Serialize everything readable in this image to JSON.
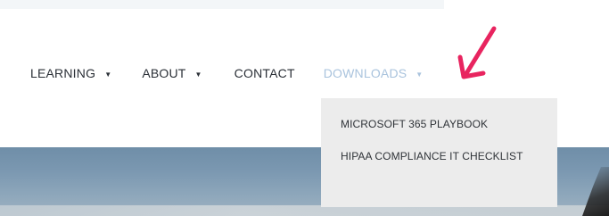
{
  "nav": {
    "items": [
      {
        "label": "LEARNING",
        "has_dropdown": true
      },
      {
        "label": "ABOUT",
        "has_dropdown": true
      },
      {
        "label": "CONTACT",
        "has_dropdown": false
      },
      {
        "label": "DOWNLOADS",
        "has_dropdown": true,
        "active": true
      }
    ],
    "caret_glyph": "▼"
  },
  "dropdown": {
    "items": [
      {
        "label": "MICROSOFT 365 PLAYBOOK"
      },
      {
        "label": "HIPAA COMPLIANCE IT CHECKLIST"
      }
    ]
  },
  "annotation": {
    "icon": "arrow-down-left-icon",
    "color": "#e8245f"
  },
  "colors": {
    "nav_text": "#2a2f36",
    "active_text": "#a9c3dd",
    "dropdown_bg": "#ececec",
    "dropdown_text": "#2f3338"
  }
}
